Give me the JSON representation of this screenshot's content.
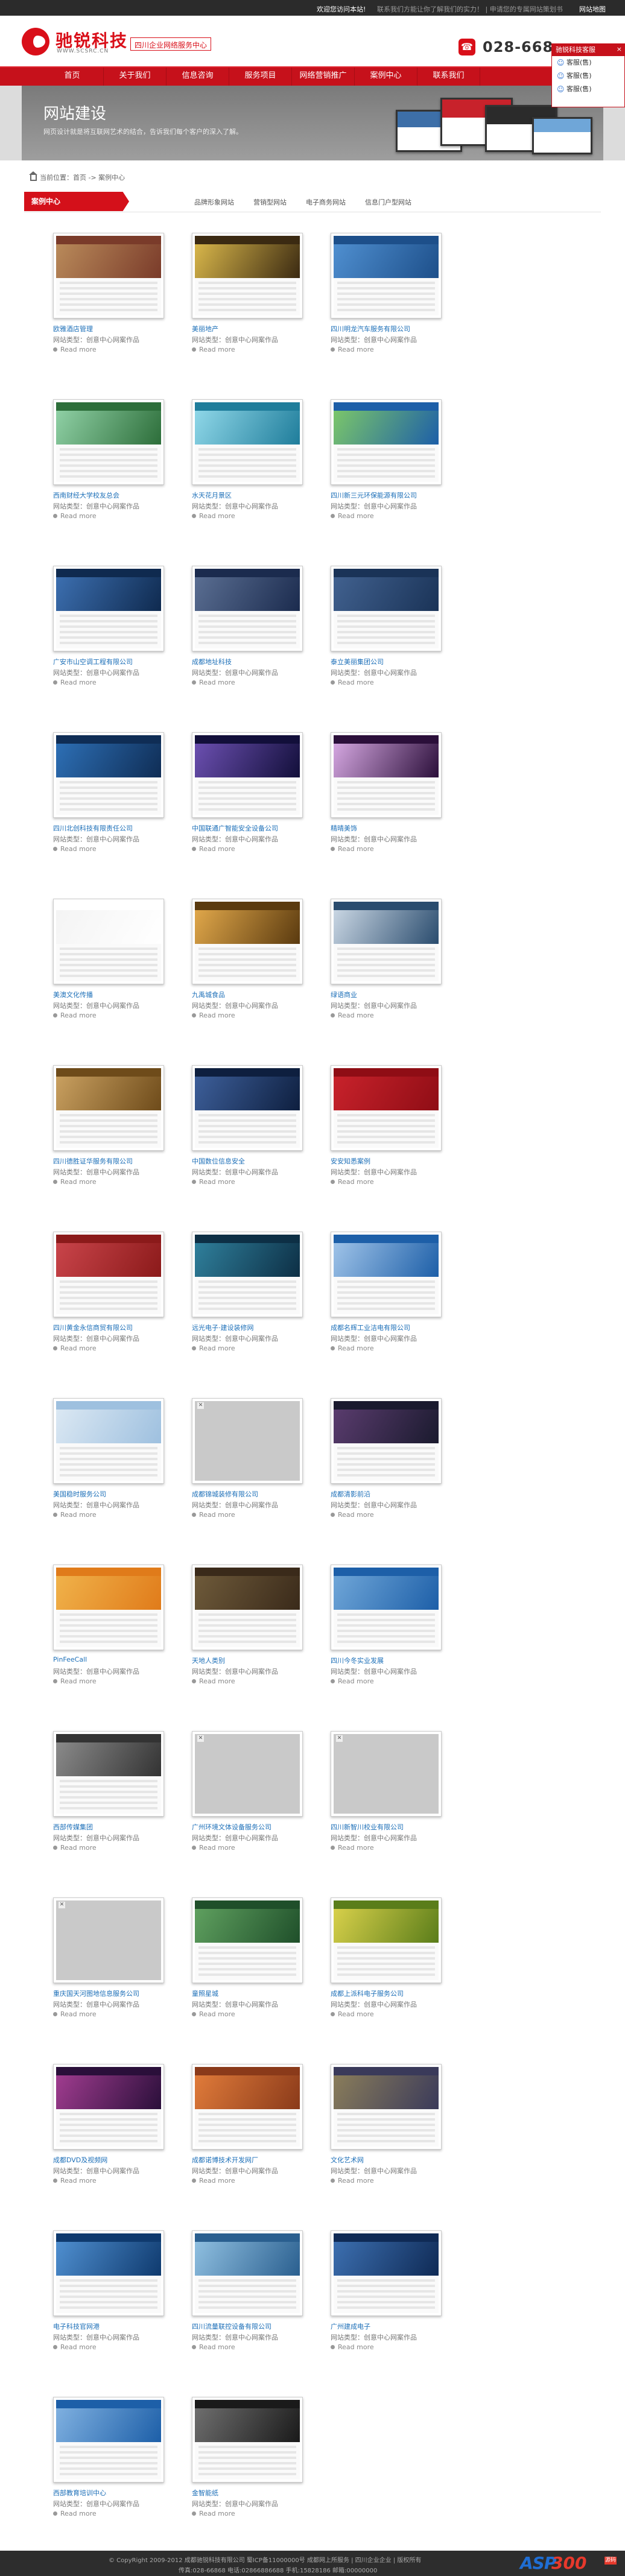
{
  "topbar": {
    "left": "欢迎您访问本站!",
    "mid": "联系我们方能让你了解我们的实力！ | 申请您的专属网站策划书",
    "right": "网站地图"
  },
  "header": {
    "brand": "驰锐科技",
    "url": "WWW.SCSRC.CN",
    "slogan": "四川企业网络服务中心",
    "phone": "028-668",
    "phone_icon": "phone-icon"
  },
  "nav": [
    "首页",
    "关于我们",
    "信息咨询",
    "服务项目",
    "网络营销推广",
    "案例中心",
    "联系我们"
  ],
  "banner": {
    "title": "网站建设",
    "subtitle": "网页设计就是将互联网艺术的结合，告诉我们每个客户的深入了解。"
  },
  "qq": {
    "title": "驰锐科技客服",
    "close": "×",
    "items": [
      "客服(售)",
      "客服(售)",
      "客服(售)"
    ]
  },
  "breadcrumb": "当前位置：首页 -> 案例中心",
  "section": {
    "current": "案例中心",
    "categories": [
      "品牌形象网站",
      "营销型网站",
      "电子商务网站",
      "信息门户型网站"
    ]
  },
  "card_type": "网站类型：创意中心网案作品",
  "card_more": "Read more",
  "cases": [
    {
      "name": "欧雅酒店管理",
      "color": "#7a3b2a",
      "hero": "#b98a5a"
    },
    {
      "name": "美丽地产",
      "color": "#3b2a12",
      "hero": "#d8b64a"
    },
    {
      "name": "四川明龙汽车服务有限公司",
      "color": "#1d4f8a",
      "hero": "#4f8fd0"
    },
    {
      "name": "西南财经大学校友总会",
      "color": "#2d6e3a",
      "hero": "#8fd0a5"
    },
    {
      "name": "水天花月景区",
      "color": "#1f7d9b",
      "hero": "#8fd7e8"
    },
    {
      "name": "四川新三元环保能源有限公司",
      "color": "#1d5fa8",
      "hero": "#7bc66a"
    },
    {
      "name": "广安市山空调工程有限公司",
      "color": "#0f2a4f",
      "hero": "#3c6fb0"
    },
    {
      "name": "成都地址科技",
      "color": "#1b2b4e",
      "hero": "#5a6e92"
    },
    {
      "name": "泰立美丽集团公司",
      "color": "#1a3357",
      "hero": "#41618f"
    },
    {
      "name": "四川北创科技有限责任公司",
      "color": "#0f2d55",
      "hero": "#2d6fb5"
    },
    {
      "name": "中国联通广智能安全设备公司",
      "color": "#120f3a",
      "hero": "#6b4fb0"
    },
    {
      "name": "精晴美饰",
      "color": "#2b0f3a",
      "hero": "#d4a6e0"
    },
    {
      "name": "美澳文化传播",
      "color": "#ffffff",
      "hero": "#f4f4f4"
    },
    {
      "name": "九禹城食品",
      "color": "#5a3a0f",
      "hero": "#e0a74a"
    },
    {
      "name": "绿语商业",
      "color": "#2a4c6e",
      "hero": "#c9d6e3"
    },
    {
      "name": "四川德胜证华服务有限公司",
      "color": "#6e4b1a",
      "hero": "#c9a060"
    },
    {
      "name": "中国数位信息安全",
      "color": "#0e1f3f",
      "hero": "#3d5f9a"
    },
    {
      "name": "安安知悉案例",
      "color": "#8f0d15",
      "hero": "#c8222b"
    },
    {
      "name": "四川黄金永信商贸有限公司",
      "color": "#8b1a1a",
      "hero": "#c9444a"
    },
    {
      "name": "远光电子·建设装修网",
      "color": "#0d2f45",
      "hero": "#2f7f9b"
    },
    {
      "name": "成都名辉工业洁电有限公司",
      "color": "#1d5fa8",
      "hero": "#9fc3e8"
    },
    {
      "name": "美国稳时服务公司",
      "color": "#9ec0df",
      "hero": "#dbe8f3"
    },
    {
      "name": "成都锦城装修有限公司",
      "color": "#c9c9c9",
      "hero": "#c9c9c9",
      "blank": true
    },
    {
      "name": "成都清影前沿",
      "color": "#1a1a2e",
      "hero": "#5a3c6e"
    },
    {
      "name": "PinFeeCall",
      "color": "#e07b1a",
      "hero": "#f0b24a"
    },
    {
      "name": "天地人类别",
      "color": "#3a2a1a",
      "hero": "#6e5a3a"
    },
    {
      "name": "四川今冬实业发展",
      "color": "#1d5fa8",
      "hero": "#6fa6d8"
    },
    {
      "name": "西部传媒集团",
      "color": "#333333",
      "hero": "#8a8a8a"
    },
    {
      "name": "广州环境文体设备服务公司",
      "color": "#c9c9c9",
      "hero": "#c9c9c9",
      "blank": true
    },
    {
      "name": "四川新智川校业有限公司",
      "color": "#c9c9c9",
      "hero": "#c9c9c9",
      "blank": true
    },
    {
      "name": "重庆国天河图地信息服务公司",
      "color": "#c9c9c9",
      "hero": "#c9c9c9",
      "blank": true
    },
    {
      "name": "童照星城",
      "color": "#1f4f2a",
      "hero": "#5fa05f"
    },
    {
      "name": "成都上派科电子服务公司",
      "color": "#5a7d1a",
      "hero": "#d8d04a"
    },
    {
      "name": "成都DVD及视频网",
      "color": "#2a0f3a",
      "hero": "#a03c8f"
    },
    {
      "name": "成都诺博技术开发网厂",
      "color": "#8a3a1a",
      "hero": "#e07b3a"
    },
    {
      "name": "文化艺术网",
      "color": "#3a3a5a",
      "hero": "#8a7d5a"
    },
    {
      "name": "电子科技官网港",
      "color": "#0f3a6e",
      "hero": "#4f8fd0"
    },
    {
      "name": "四川流量联控设备有限公司",
      "color": "#2a5f8f",
      "hero": "#8fbfe0"
    },
    {
      "name": "广州建成电子",
      "color": "#0f2a55",
      "hero": "#3c6fb0"
    },
    {
      "name": "西部教育培训中心",
      "color": "#1d5fa8",
      "hero": "#7fb0e0"
    },
    {
      "name": "金智能纸",
      "color": "#1a1a1a",
      "hero": "#6e6e6e"
    }
  ],
  "footer": {
    "line1": "© CopyRight 2009-2012 成都驰锐科技有限公司  蜀ICP备11000000号  成都网上所服务 | 四川企业企业 | 版权所有",
    "line2": "传真:028-66868 电话:02866886688 手机:15828186 邮箱:00000000",
    "logo_a": "ASP",
    "logo_b": "300",
    "logo_c": "源码"
  },
  "colors": {
    "brand_red": "#c6111b",
    "link_blue": "#1c6fb8"
  }
}
